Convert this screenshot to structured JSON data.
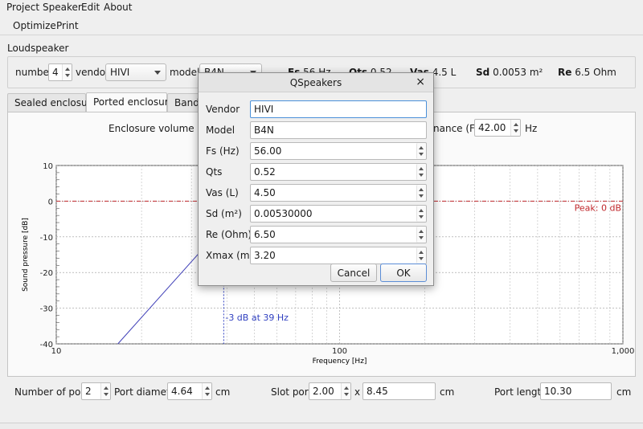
{
  "menubar": {
    "items": [
      "Project",
      "Speaker",
      "Edit",
      "About"
    ]
  },
  "toolbar": {
    "items": [
      "Optimize",
      "Print"
    ]
  },
  "loudspeaker": {
    "title": "Loudspeaker",
    "number_label": "number",
    "number_value": "4",
    "vendor_label": "vendor",
    "vendor_value": "HIVI",
    "model_label": "model",
    "model_value": "B4N",
    "specs": [
      {
        "name": "Fs",
        "value": "56 Hz"
      },
      {
        "name": "Qts",
        "value": "0.52"
      },
      {
        "name": "Vas",
        "value": "4.5 L"
      },
      {
        "name": "Sd",
        "value": "0.0053 m²"
      },
      {
        "name": "Re",
        "value": "6.5 Ohm"
      }
    ]
  },
  "tabs": [
    "Sealed enclosure",
    "Ported enclosure",
    "Bandpass"
  ],
  "ported": {
    "volume_label": "Enclosure volume (Vb)",
    "resonance_label": "nance (Fb)",
    "resonance_value": "42.00",
    "resonance_unit": "Hz",
    "ports_label": "Number of ports",
    "ports_value": "2",
    "diameter_label": "Port diameter",
    "diameter_value": "4.64",
    "diameter_unit": "cm",
    "slot_label": "Slot port",
    "slot_w": "2.00",
    "slot_x": "x",
    "slot_h": "8.45",
    "slot_unit": "cm",
    "length_label": "Port length",
    "length_value": "10.30",
    "length_unit": "cm"
  },
  "chart_data": {
    "type": "line",
    "xlabel": "Frequency [Hz]",
    "ylabel": "Sound pressure [dB]",
    "xscale": "log",
    "xlim": [
      10,
      1000
    ],
    "ylim": [
      -40,
      10
    ],
    "xticks": [
      "10",
      "100",
      "1,000"
    ],
    "yticks": [
      "10",
      "0",
      "-10",
      "-20",
      "-30",
      "-40"
    ],
    "grid": true,
    "series": [
      {
        "x": [
          16.5,
          35
        ],
        "y": [
          -40,
          -11
        ]
      }
    ],
    "annotations": {
      "peak": "Peak: 0 dB",
      "cutoff": "-3 dB at 39 Hz",
      "cutoff_x": 39,
      "peak_y": 0
    },
    "colors": {
      "curve": "#4040b8",
      "peak_line": "#c0282c",
      "cutoff": "#3040c0"
    }
  },
  "dialog": {
    "title": "QSpeakers",
    "close": "×",
    "fields": [
      {
        "label": "Vendor",
        "value": "HIVI"
      },
      {
        "label": "Model",
        "value": "B4N"
      },
      {
        "label": "Fs (Hz)",
        "value": "56.00"
      },
      {
        "label": "Qts",
        "value": "0.52"
      },
      {
        "label": "Vas (L)",
        "value": "4.50"
      },
      {
        "label": "Sd (m²)",
        "value": "0.00530000"
      },
      {
        "label": "Re (Ohm)",
        "value": "6.50"
      },
      {
        "label": "Xmax (mm)",
        "value": "3.20"
      }
    ],
    "cancel": "Cancel",
    "ok": "OK"
  }
}
